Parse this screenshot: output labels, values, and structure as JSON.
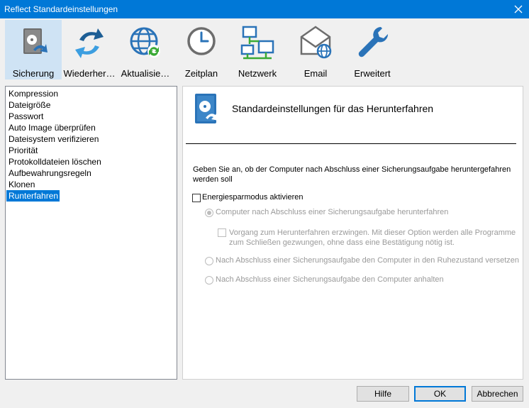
{
  "window": {
    "title": "Reflect Standardeinstellungen"
  },
  "toolbar": {
    "items": [
      {
        "label": "Sicherung",
        "icon": "backup-drive-icon"
      },
      {
        "label": "Wiederher…",
        "icon": "restore-arrows-icon"
      },
      {
        "label": "Aktualisie…",
        "icon": "update-globe-icon"
      },
      {
        "label": "Zeitplan",
        "icon": "clock-icon"
      },
      {
        "label": "Netzwerk",
        "icon": "network-icon"
      },
      {
        "label": "Email",
        "icon": "email-icon"
      },
      {
        "label": "Erweitert",
        "icon": "wrench-icon"
      }
    ]
  },
  "sidebar": {
    "items": [
      "Kompression",
      "Dateigröße",
      "Passwort",
      "Auto Image überprüfen",
      "Dateisystem verifizieren",
      "Priorität",
      "Protokolldateien löschen",
      "Aufbewahrungsregeln",
      "Klonen",
      "Runterfahren"
    ],
    "selected": "Runterfahren"
  },
  "panel": {
    "title": "Standardeinstellungen für das Herunterfahren",
    "description": "Geben Sie an, ob der Computer nach Abschluss einer Sicherungsaufgabe heruntergefahren werden soll",
    "enable_checkbox": {
      "label": "Energiesparmodus aktivieren",
      "checked": false
    },
    "option_shutdown": {
      "label": "Computer nach Abschluss einer Sicherungsaufgabe herunterfahren",
      "selected": true
    },
    "force_checkbox": {
      "label": "Vorgang zum Herunterfahren erzwingen. Mit dieser Option werden alle Programme zum Schließen gezwungen, ohne dass eine Bestätigung nötig ist.",
      "checked": false
    },
    "option_hibernate": {
      "label": "Nach Abschluss einer Sicherungsaufgabe den Computer in den Ruhezustand versetzen",
      "selected": false
    },
    "option_halt": {
      "label": "Nach Abschluss einer Sicherungsaufgabe den Computer anhalten",
      "selected": false
    }
  },
  "buttons": {
    "help": "Hilfe",
    "ok": "OK",
    "cancel": "Abbrechen"
  },
  "colors": {
    "accent": "#0078d7",
    "selected_tab": "#cfe3f4",
    "icon_blue": "#2a73b8",
    "icon_gray": "#6d6d6d",
    "icon_green": "#3aaa35"
  }
}
